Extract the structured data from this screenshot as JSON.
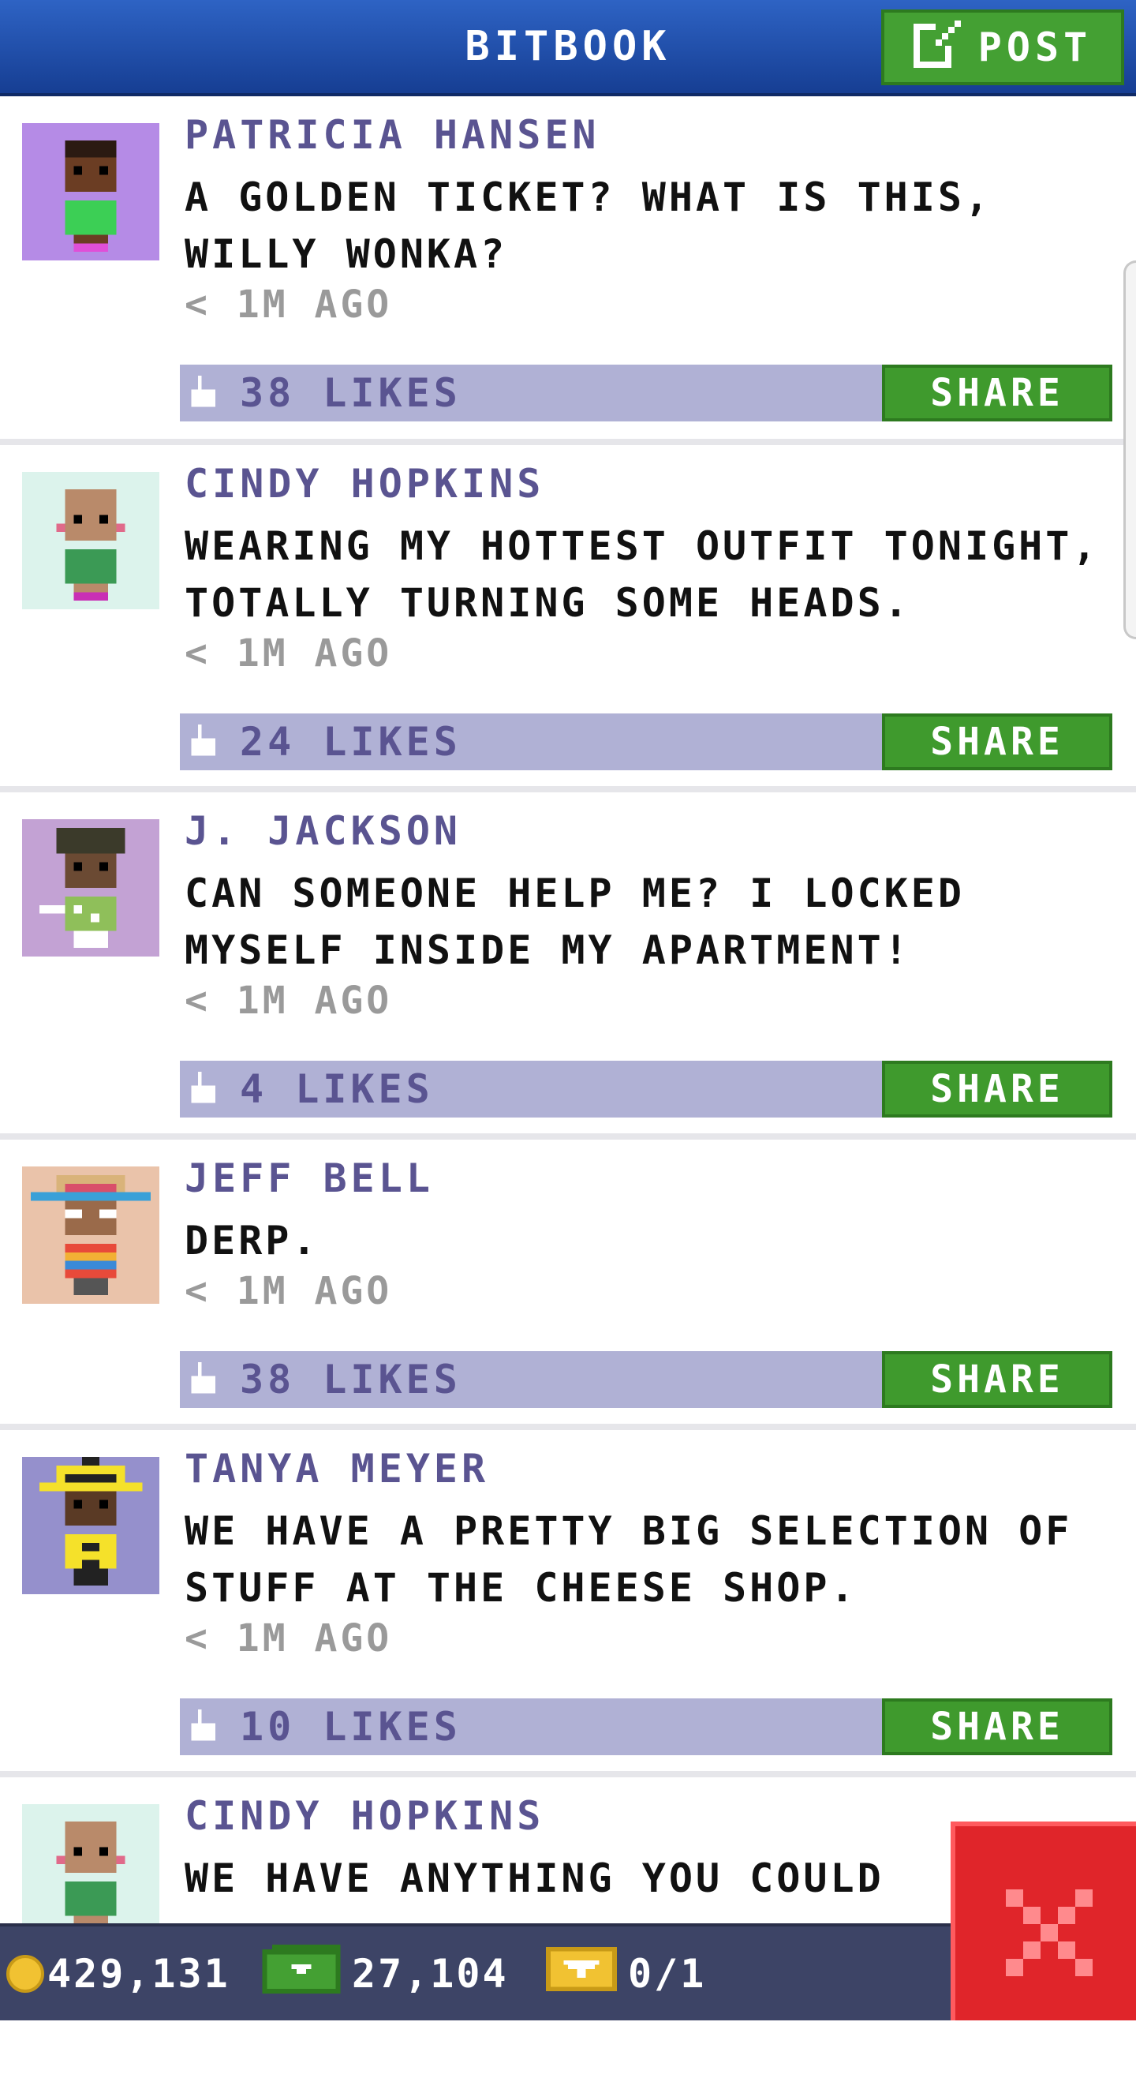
{
  "header": {
    "title": "BITBOOK",
    "post_label": "POST"
  },
  "posts": [
    {
      "author": "PATRICIA HANSEN",
      "text": "A GOLDEN TICKET? WHAT IS THIS, WILLY WONKA?",
      "time": "< 1M AGO",
      "likes": "38 LIKES",
      "share_label": "SHARE",
      "avatar_bg": "#b58be6"
    },
    {
      "author": "CINDY HOPKINS",
      "text": "WEARING MY HOTTEST OUTFIT TONIGHT, TOTALLY TURNING SOME HEADS.",
      "time": "< 1M AGO",
      "likes": "24 LIKES",
      "share_label": "SHARE",
      "avatar_bg": "#dcf3ec"
    },
    {
      "author": "J. JACKSON",
      "text": "CAN SOMEONE HELP ME? I LOCKED MYSELF INSIDE MY APARTMENT!",
      "time": "< 1M AGO",
      "likes": "4 LIKES",
      "share_label": "SHARE",
      "avatar_bg": "#c3a2d4"
    },
    {
      "author": "JEFF BELL",
      "text": "DERP.",
      "time": "< 1M AGO",
      "likes": "38 LIKES",
      "share_label": "SHARE",
      "avatar_bg": "#eac3aa"
    },
    {
      "author": "TANYA MEYER",
      "text": "WE HAVE A PRETTY BIG SELECTION OF STUFF AT THE CHEESE SHOP.",
      "time": "< 1M AGO",
      "likes": "10 LIKES",
      "share_label": "SHARE",
      "avatar_bg": "#9590cc"
    },
    {
      "author": "CINDY HOPKINS",
      "text": "WE HAVE ANYTHING YOU COULD",
      "avatar_bg": "#dcf3ec"
    }
  ],
  "footer": {
    "coins": "429,131",
    "bux": "27,104",
    "tickets": "0/1"
  },
  "colors": {
    "accent_green": "#44a033",
    "header_blue": "#2e63c4",
    "likebar": "#b0b1d5",
    "close_red": "#e0252a"
  },
  "icons": {
    "post": "edit-icon",
    "like": "thumbs-up-icon",
    "coin": "coin-icon",
    "bux": "bux-icon",
    "ticket": "ticket-icon",
    "close": "close-icon"
  }
}
